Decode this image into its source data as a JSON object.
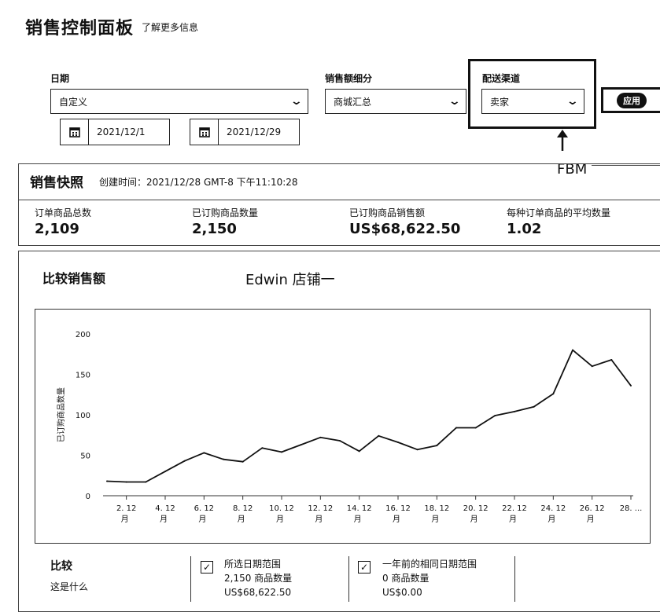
{
  "header": {
    "title": "销售控制面板",
    "learn_more": "了解更多信息"
  },
  "filters": {
    "date": {
      "label": "日期",
      "value": "自定义",
      "start": "2021/12/1",
      "end": "2021/12/29"
    },
    "sales_breakdown": {
      "label": "销售额细分",
      "value": "商城汇总"
    },
    "channel": {
      "label": "配送渠道",
      "value": "卖家"
    },
    "apply_label": "应用"
  },
  "annotations": {
    "fbm": "FBM",
    "store": "Edwin 店铺一"
  },
  "snapshot": {
    "title": "销售快照",
    "created": "创建时间：2021/12/28 GMT-8 下午11:10:28",
    "metrics": [
      {
        "label": "订单商品总数",
        "value": "2,109"
      },
      {
        "label": "已订购商品数量",
        "value": "2,150"
      },
      {
        "label": "已订购商品销售额",
        "value": "US$68,622.50"
      },
      {
        "label": "每种订单商品的平均数量",
        "value": "1.02"
      }
    ]
  },
  "compare": {
    "title": "比较销售额",
    "heading": "比较",
    "what": "这是什么",
    "items": [
      {
        "title": "所选日期范围",
        "qty": "2,150 商品数量",
        "sales": "US$68,622.50",
        "checked": true
      },
      {
        "title": "一年前的相同日期范围",
        "qty": "0 商品数量",
        "sales": "US$0.00",
        "checked": true
      }
    ]
  },
  "chart_data": {
    "type": "line",
    "ylabel": "已订购商品数量",
    "ylim": [
      0,
      200
    ],
    "yticks": [
      "200",
      "150",
      "100",
      "50",
      "0"
    ],
    "xticks": [
      {
        "d": "2. 12",
        "m": "月"
      },
      {
        "d": "4. 12",
        "m": "月"
      },
      {
        "d": "6. 12",
        "m": "月"
      },
      {
        "d": "8. 12",
        "m": "月"
      },
      {
        "d": "10. 12",
        "m": "月"
      },
      {
        "d": "12. 12",
        "m": "月"
      },
      {
        "d": "14. 12",
        "m": "月"
      },
      {
        "d": "16. 12",
        "m": "月"
      },
      {
        "d": "18. 12",
        "m": "月"
      },
      {
        "d": "20. 12",
        "m": "月"
      },
      {
        "d": "22. 12",
        "m": "月"
      },
      {
        "d": "24. 12",
        "m": "月"
      },
      {
        "d": "26. 12",
        "m": "月"
      },
      {
        "d": "28. ...",
        "m": ""
      }
    ],
    "x": [
      "12/1",
      "12/2",
      "12/3",
      "12/4",
      "12/5",
      "12/6",
      "12/7",
      "12/8",
      "12/9",
      "12/10",
      "12/11",
      "12/12",
      "12/13",
      "12/14",
      "12/15",
      "12/16",
      "12/17",
      "12/18",
      "12/19",
      "12/20",
      "12/21",
      "12/22",
      "12/23",
      "12/24",
      "12/25",
      "12/26",
      "12/27",
      "12/28"
    ],
    "values": [
      18,
      17,
      17,
      30,
      43,
      53,
      45,
      42,
      59,
      54,
      63,
      72,
      68,
      55,
      74,
      66,
      57,
      62,
      84,
      84,
      99,
      104,
      110,
      126,
      180,
      160,
      168,
      136
    ]
  }
}
